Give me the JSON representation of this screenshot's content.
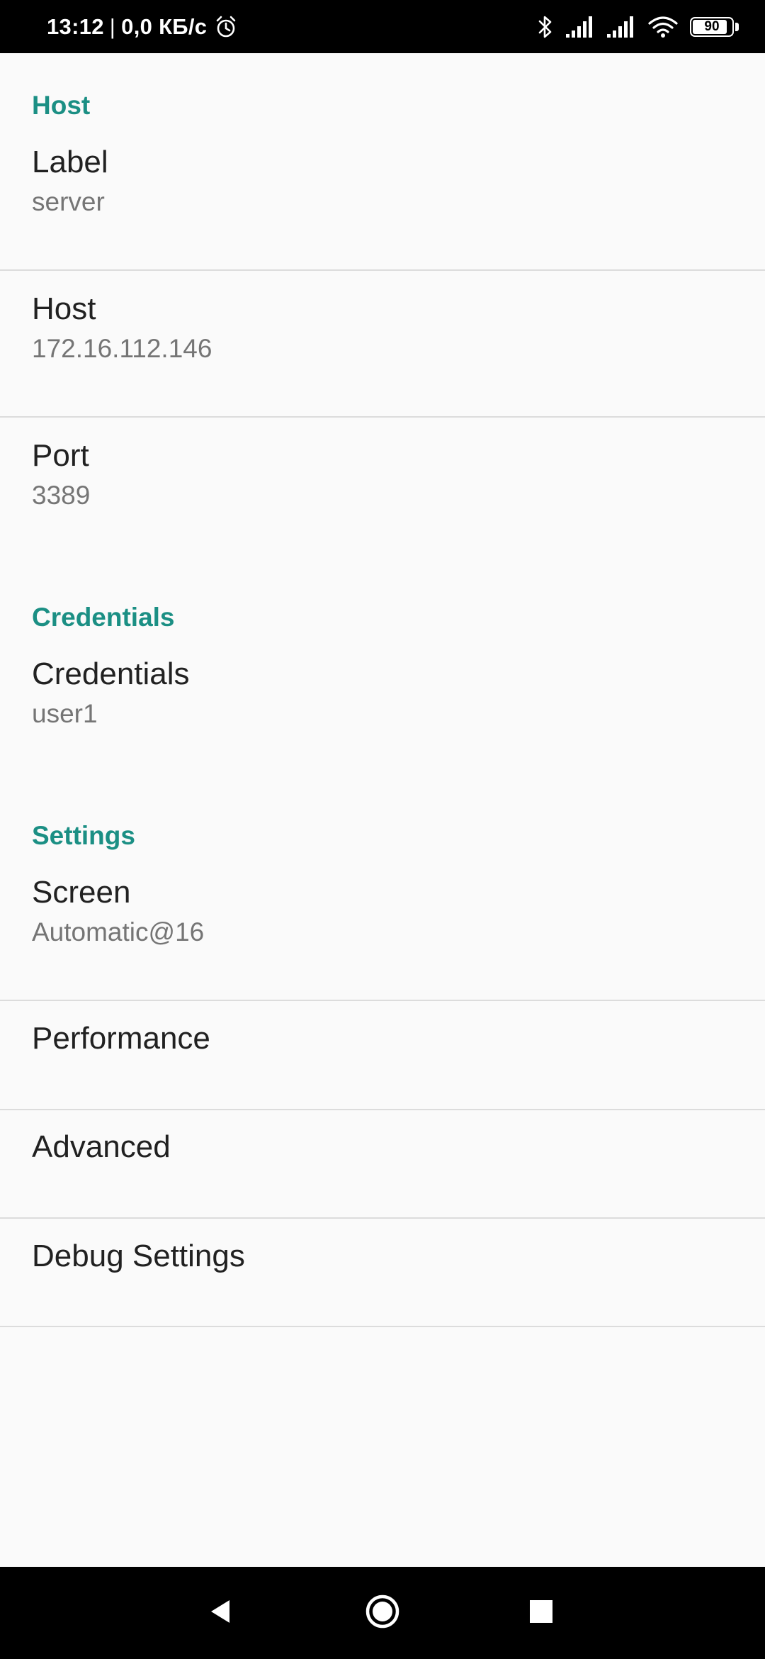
{
  "status_bar": {
    "time": "13:12",
    "separator": "|",
    "network_speed": "0,0 КБ/с",
    "alarm_icon": "alarm-clock-icon",
    "bluetooth_icon": "bluetooth-icon",
    "signal_icons": [
      "signal-bars-icon",
      "signal-bars-icon"
    ],
    "wifi_icon": "wifi-icon",
    "battery_level": "90",
    "battery_fraction": 0.9
  },
  "sections": {
    "host": {
      "header": "Host",
      "label": {
        "title": "Label",
        "summary": "server"
      },
      "host": {
        "title": "Host",
        "summary": "172.16.112.146"
      },
      "port": {
        "title": "Port",
        "summary": "3389"
      }
    },
    "credentials": {
      "header": "Credentials",
      "credentials": {
        "title": "Credentials",
        "summary": "user1"
      }
    },
    "settings": {
      "header": "Settings",
      "screen": {
        "title": "Screen",
        "summary": "Automatic@16"
      },
      "performance": {
        "title": "Performance"
      },
      "advanced": {
        "title": "Advanced"
      },
      "debug": {
        "title": "Debug Settings"
      }
    }
  },
  "nav_bar": {
    "back_icon": "back-triangle-icon",
    "home_icon": "home-circle-icon",
    "recents_icon": "recents-square-icon"
  },
  "colors": {
    "accent": "#1b8f84",
    "background": "#fafafa",
    "title_text": "#212121",
    "summary_text": "#757575",
    "divider": "#dcdcdc",
    "system_bars": "#000000"
  }
}
